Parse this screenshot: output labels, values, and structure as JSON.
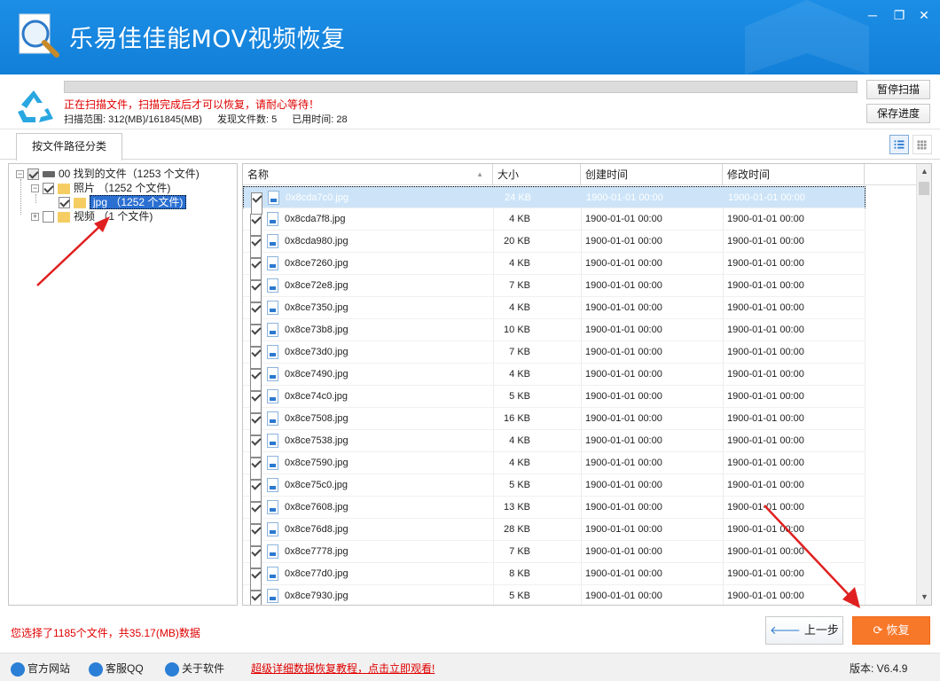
{
  "app": {
    "title": "乐易佳佳能MOV视频恢复"
  },
  "window_controls": {
    "minimize": "─",
    "maximize": "❐",
    "close": "✕"
  },
  "status": {
    "progress": 0.0,
    "message": "正在扫描文件，扫描完成后才可以恢复，请耐心等待！",
    "range": "扫描范围: 312(MB)/161845(MB)",
    "found": "发现文件数: 5",
    "elapsed": "已用时间: 28",
    "pause_label": "暂停扫描",
    "save_label": "保存进度"
  },
  "tabs": {
    "active": "按文件路径分类"
  },
  "tree": {
    "root": "00 找到的文件（1253 个文件)",
    "photos": "照片  （1252 个文件)",
    "jpg": "jpg  （1252 个文件)",
    "videos": "视频  （1 个文件)"
  },
  "table": {
    "headers": {
      "name": "名称",
      "size": "大小",
      "ctime": "创建时间",
      "mtime": "修改时间"
    },
    "rows": [
      {
        "name": "0x8cda7c0.jpg",
        "size": "24 KB",
        "ctime": "1900-01-01  00:00",
        "mtime": "1900-01-01  00:00"
      },
      {
        "name": "0x8cda7f8.jpg",
        "size": "4 KB",
        "ctime": "1900-01-01  00:00",
        "mtime": "1900-01-01  00:00"
      },
      {
        "name": "0x8cda980.jpg",
        "size": "20 KB",
        "ctime": "1900-01-01  00:00",
        "mtime": "1900-01-01  00:00"
      },
      {
        "name": "0x8ce7260.jpg",
        "size": "4 KB",
        "ctime": "1900-01-01  00:00",
        "mtime": "1900-01-01  00:00"
      },
      {
        "name": "0x8ce72e8.jpg",
        "size": "7 KB",
        "ctime": "1900-01-01  00:00",
        "mtime": "1900-01-01  00:00"
      },
      {
        "name": "0x8ce7350.jpg",
        "size": "4 KB",
        "ctime": "1900-01-01  00:00",
        "mtime": "1900-01-01  00:00"
      },
      {
        "name": "0x8ce73b8.jpg",
        "size": "10 KB",
        "ctime": "1900-01-01  00:00",
        "mtime": "1900-01-01  00:00"
      },
      {
        "name": "0x8ce73d0.jpg",
        "size": "7 KB",
        "ctime": "1900-01-01  00:00",
        "mtime": "1900-01-01  00:00"
      },
      {
        "name": "0x8ce7490.jpg",
        "size": "4 KB",
        "ctime": "1900-01-01  00:00",
        "mtime": "1900-01-01  00:00"
      },
      {
        "name": "0x8ce74c0.jpg",
        "size": "5 KB",
        "ctime": "1900-01-01  00:00",
        "mtime": "1900-01-01  00:00"
      },
      {
        "name": "0x8ce7508.jpg",
        "size": "16 KB",
        "ctime": "1900-01-01  00:00",
        "mtime": "1900-01-01  00:00"
      },
      {
        "name": "0x8ce7538.jpg",
        "size": "4 KB",
        "ctime": "1900-01-01  00:00",
        "mtime": "1900-01-01  00:00"
      },
      {
        "name": "0x8ce7590.jpg",
        "size": "4 KB",
        "ctime": "1900-01-01  00:00",
        "mtime": "1900-01-01  00:00"
      },
      {
        "name": "0x8ce75c0.jpg",
        "size": "5 KB",
        "ctime": "1900-01-01  00:00",
        "mtime": "1900-01-01  00:00"
      },
      {
        "name": "0x8ce7608.jpg",
        "size": "13 KB",
        "ctime": "1900-01-01  00:00",
        "mtime": "1900-01-01  00:00"
      },
      {
        "name": "0x8ce76d8.jpg",
        "size": "28 KB",
        "ctime": "1900-01-01  00:00",
        "mtime": "1900-01-01  00:00"
      },
      {
        "name": "0x8ce7778.jpg",
        "size": "7 KB",
        "ctime": "1900-01-01  00:00",
        "mtime": "1900-01-01  00:00"
      },
      {
        "name": "0x8ce77d0.jpg",
        "size": "8 KB",
        "ctime": "1900-01-01  00:00",
        "mtime": "1900-01-01  00:00"
      },
      {
        "name": "0x8ce7930.jpg",
        "size": "5 KB",
        "ctime": "1900-01-01  00:00",
        "mtime": "1900-01-01  00:00"
      }
    ]
  },
  "bottom": {
    "selection_info": "您选择了1185个文件，共35.17(MB)数据",
    "prev_label": "上一步",
    "recover_label": "恢复"
  },
  "footer": {
    "website": "官方网站",
    "qq": "客服QQ",
    "about": "关于软件",
    "promo": "超级详细数据恢复教程，点击立即观看!",
    "version": "版本: V6.4.9"
  },
  "colors": {
    "titlebar": "#1c8ee6",
    "accent_orange": "#f8782a",
    "warning_red": "#e00000",
    "annotation_red": "#e02020"
  }
}
